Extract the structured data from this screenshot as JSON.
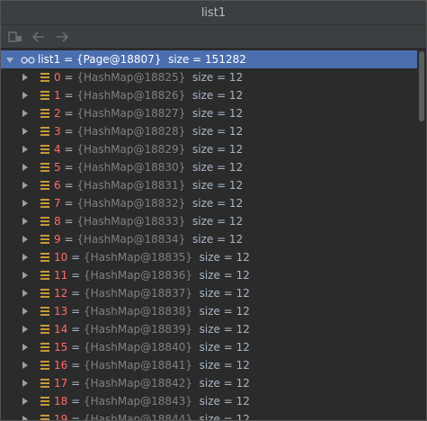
{
  "window": {
    "title": "list1"
  },
  "toolbar": {
    "buttons": [
      {
        "name": "layout-icon"
      },
      {
        "name": "back-arrow-icon"
      },
      {
        "name": "forward-arrow-icon"
      }
    ]
  },
  "root": {
    "name": "list1",
    "equals": " = ",
    "type": "{Page@18807}",
    "size_text": "size = 151282"
  },
  "items": [
    {
      "index": "0",
      "type": "{HashMap@18825}",
      "size_text": "size = 12"
    },
    {
      "index": "1",
      "type": "{HashMap@18826}",
      "size_text": "size = 12"
    },
    {
      "index": "2",
      "type": "{HashMap@18827}",
      "size_text": "size = 12"
    },
    {
      "index": "3",
      "type": "{HashMap@18828}",
      "size_text": "size = 12"
    },
    {
      "index": "4",
      "type": "{HashMap@18829}",
      "size_text": "size = 12"
    },
    {
      "index": "5",
      "type": "{HashMap@18830}",
      "size_text": "size = 12"
    },
    {
      "index": "6",
      "type": "{HashMap@18831}",
      "size_text": "size = 12"
    },
    {
      "index": "7",
      "type": "{HashMap@18832}",
      "size_text": "size = 12"
    },
    {
      "index": "8",
      "type": "{HashMap@18833}",
      "size_text": "size = 12"
    },
    {
      "index": "9",
      "type": "{HashMap@18834}",
      "size_text": "size = 12"
    },
    {
      "index": "10",
      "type": "{HashMap@18835}",
      "size_text": "size = 12"
    },
    {
      "index": "11",
      "type": "{HashMap@18836}",
      "size_text": "size = 12"
    },
    {
      "index": "12",
      "type": "{HashMap@18837}",
      "size_text": "size = 12"
    },
    {
      "index": "13",
      "type": "{HashMap@18838}",
      "size_text": "size = 12"
    },
    {
      "index": "14",
      "type": "{HashMap@18839}",
      "size_text": "size = 12"
    },
    {
      "index": "15",
      "type": "{HashMap@18840}",
      "size_text": "size = 12"
    },
    {
      "index": "16",
      "type": "{HashMap@18841}",
      "size_text": "size = 12"
    },
    {
      "index": "17",
      "type": "{HashMap@18842}",
      "size_text": "size = 12"
    },
    {
      "index": "18",
      "type": "{HashMap@18843}",
      "size_text": "size = 12"
    },
    {
      "index": "19",
      "type": "{HashMap@18844}",
      "size_text": "size = 12"
    }
  ],
  "equals_sign": " = "
}
